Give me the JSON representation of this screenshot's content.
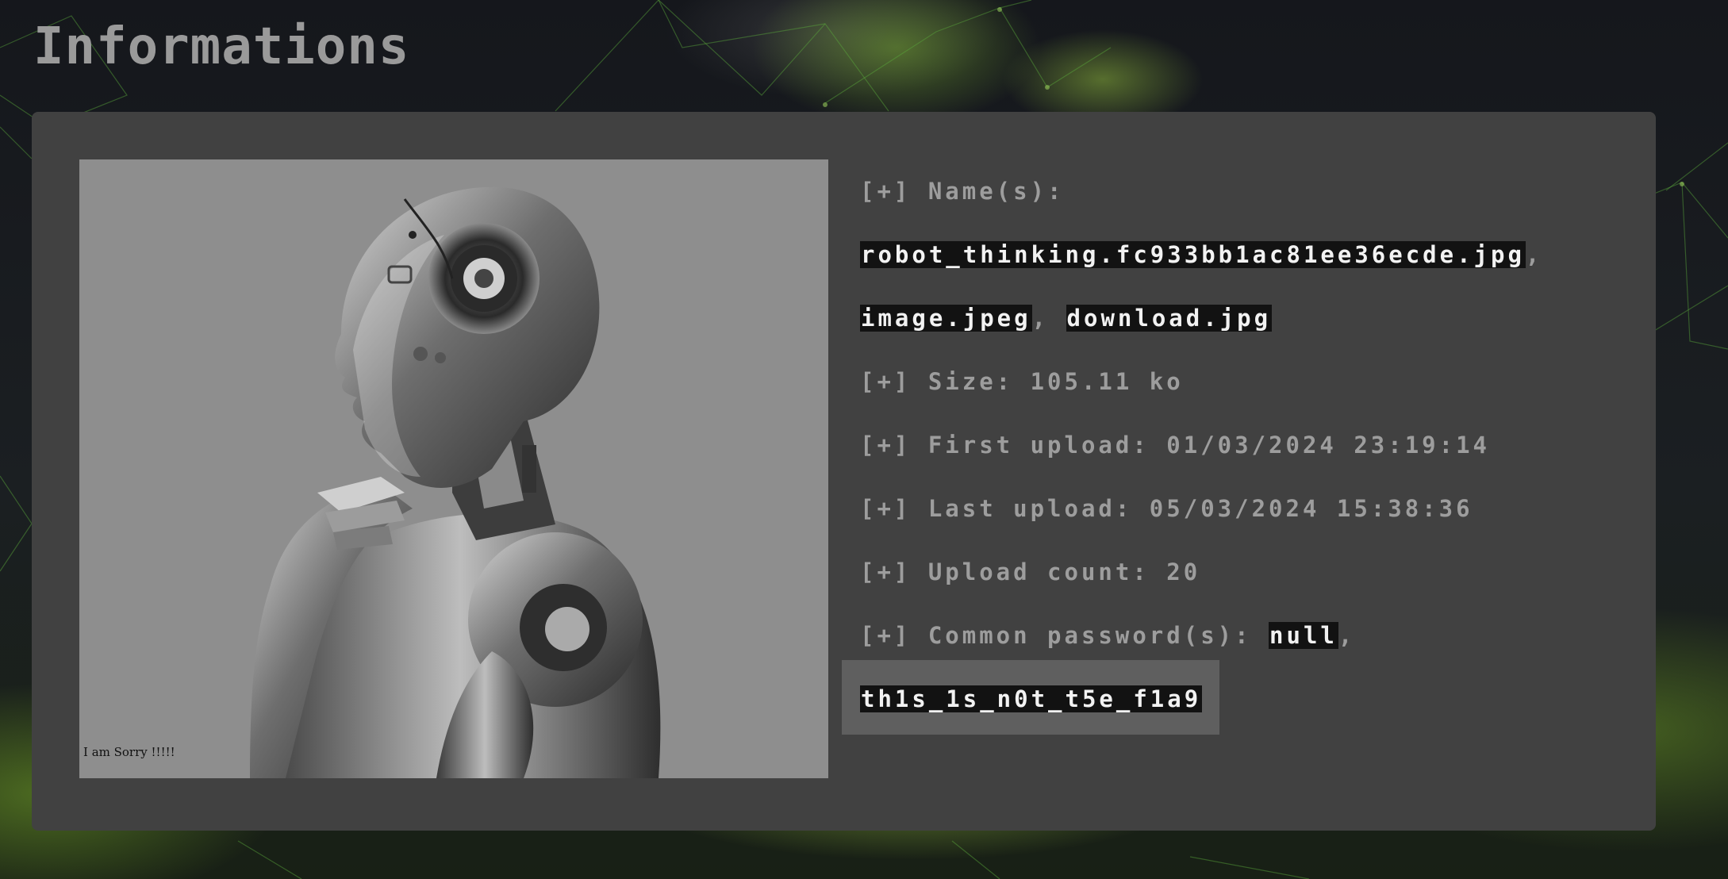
{
  "page": {
    "title": "Informations"
  },
  "image": {
    "caption": "I am Sorry !!!!!",
    "description_icon": "robot-thinking-image"
  },
  "info": {
    "names_label": "[+] Name(s):",
    "names": [
      "robot_thinking.fc933bb1ac81ee36ecde.jpg",
      "image.jpeg",
      "download.jpg"
    ],
    "separator": ",",
    "size_label": "[+] Size: 105.11 ko",
    "first_upload_label": "[+] First upload: 01/03/2024 23:19:14",
    "last_upload_label": "[+] Last upload: 05/03/2024 15:38:36",
    "upload_count_label": "[+] Upload count: 20",
    "password_label": "[+] Common password(s): ",
    "passwords": [
      "null",
      "th1s_1s_n0t_t5e_f1a9"
    ]
  },
  "colors": {
    "card": "#414141",
    "highlight": "#121212",
    "text": "#9d9d9d",
    "accent_green": "#7fb23a"
  }
}
